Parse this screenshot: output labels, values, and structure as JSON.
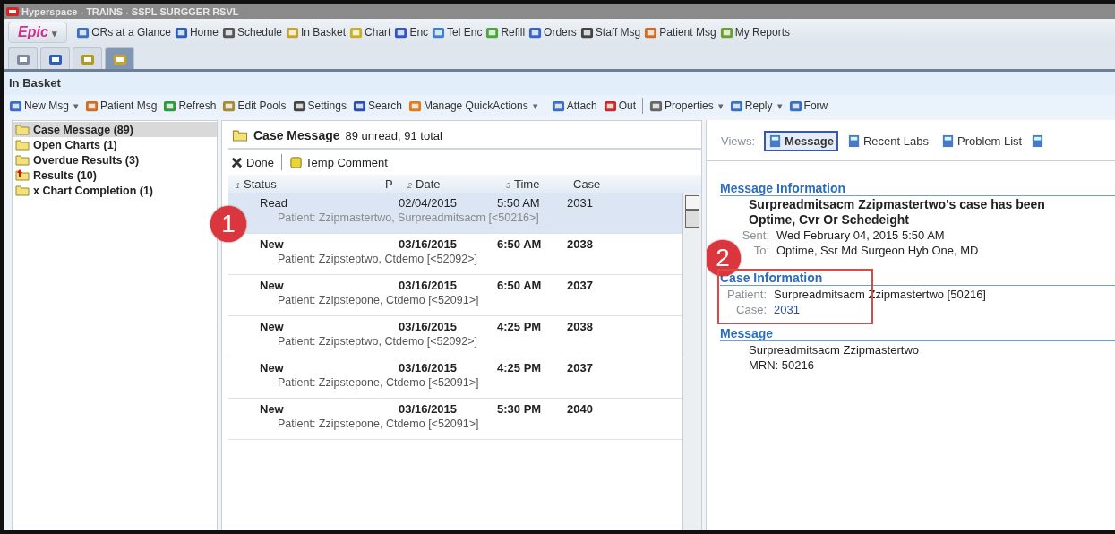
{
  "window": {
    "title": "Hyperspace - TRAINS - SSPL SURGGER RSVL"
  },
  "main_toolbar": {
    "menu_button": "Epic",
    "menu_caret": "▾",
    "items": [
      "ORs at a Glance",
      "Home",
      "Schedule",
      "In Basket",
      "Chart",
      "Enc",
      "Tel Enc",
      "Refill",
      "Orders",
      "Staff Msg",
      "Patient Msg",
      "My Reports"
    ]
  },
  "workspace_tabs": [
    {
      "selected": false
    },
    {
      "selected": false
    },
    {
      "selected": false
    },
    {
      "selected": true
    }
  ],
  "activity_title": "In Basket",
  "in_basket_toolbar": [
    {
      "kind": "button",
      "label": "New Msg",
      "caret": "▾"
    },
    {
      "kind": "button",
      "label": "Patient Msg"
    },
    {
      "kind": "button",
      "label": "Refresh"
    },
    {
      "kind": "button",
      "label": "Edit Pools"
    },
    {
      "kind": "button",
      "label": "Settings"
    },
    {
      "kind": "button",
      "label": "Search"
    },
    {
      "kind": "button",
      "label": "Manage QuickActions",
      "caret": "▾"
    },
    {
      "kind": "separator"
    },
    {
      "kind": "button",
      "label": "Attach"
    },
    {
      "kind": "button",
      "label": "Out"
    },
    {
      "kind": "separator"
    },
    {
      "kind": "button",
      "label": "Properties",
      "caret": "▾"
    },
    {
      "kind": "button",
      "label": "Reply",
      "caret": "▾"
    },
    {
      "kind": "button",
      "label": "Forw"
    }
  ],
  "folders": [
    {
      "label": "Case Message (89)",
      "kind": "folder",
      "selected": true
    },
    {
      "label": "Open Charts (1)",
      "kind": "folder",
      "selected": false
    },
    {
      "label": "Overdue Results (3)",
      "kind": "folder",
      "selected": false
    },
    {
      "label": "Results (10)",
      "kind": "alert",
      "selected": false
    },
    {
      "label": "x Chart Completion (1)",
      "kind": "folder",
      "selected": false
    }
  ],
  "message_list": {
    "folder": "Case Message",
    "summary": "89 unread, 91 total",
    "actions": [
      "Done",
      "Temp Comment"
    ],
    "columns": [
      {
        "label": "Status",
        "sort": "1"
      },
      {
        "label": "P"
      },
      {
        "label": "Date",
        "sort": "2"
      },
      {
        "label": "Time",
        "sort": "3"
      },
      {
        "label": "Case"
      }
    ],
    "rows": [
      {
        "status": "Read",
        "date": "02/04/2015",
        "time": "5:50 AM",
        "case": "2031",
        "patient": "Patient: Zzipmastertwo, Surpreadmitsacm [<50216>]",
        "unread": false,
        "selected": true
      },
      {
        "status": "New",
        "date": "03/16/2015",
        "time": "6:50 AM",
        "case": "2038",
        "patient": "Patient: Zzipsteptwo, Ctdemo [<52092>]",
        "unread": true,
        "selected": false
      },
      {
        "status": "New",
        "date": "03/16/2015",
        "time": "6:50 AM",
        "case": "2037",
        "patient": "Patient: Zzipstepone, Ctdemo [<52091>]",
        "unread": true,
        "selected": false
      },
      {
        "status": "New",
        "date": "03/16/2015",
        "time": "4:25 PM",
        "case": "2038",
        "patient": "Patient: Zzipsteptwo, Ctdemo [<52092>]",
        "unread": true,
        "selected": false
      },
      {
        "status": "New",
        "date": "03/16/2015",
        "time": "4:25 PM",
        "case": "2037",
        "patient": "Patient: Zzipstepone, Ctdemo [<52091>]",
        "unread": true,
        "selected": false
      },
      {
        "status": "New",
        "date": "03/16/2015",
        "time": "5:30 PM",
        "case": "2040",
        "patient": "Patient: Zzipstepone, Ctdemo [<52091>]",
        "unread": true,
        "selected": false
      }
    ]
  },
  "detail": {
    "views_label": "Views:",
    "views": [
      {
        "label": "Message",
        "selected": true
      },
      {
        "label": "Recent Labs",
        "selected": false
      },
      {
        "label": "Problem List",
        "selected": false
      }
    ],
    "message_information": {
      "heading": "Message Information",
      "subject": "Surpreadmitsacm Zzipmastertwo's case has been",
      "from": "Optime, Cvr Or Schedeight",
      "sent_label": "Sent:",
      "sent": "Wed February 04, 2015  5:50 AM",
      "to_label": "To:",
      "to": "Optime, Ssr Md Surgeon Hyb One, MD"
    },
    "case_information": {
      "heading": "Case Information",
      "patient_label": "Patient:",
      "patient": "Surpreadmitsacm Zzipmastertwo [50216]",
      "case_label": "Case:",
      "case": "2031"
    },
    "message": {
      "heading": "Message",
      "lines": [
        "Surpreadmitsacm Zzipmastertwo",
        "MRN: 50216"
      ]
    }
  },
  "callouts": [
    "1",
    "2"
  ]
}
